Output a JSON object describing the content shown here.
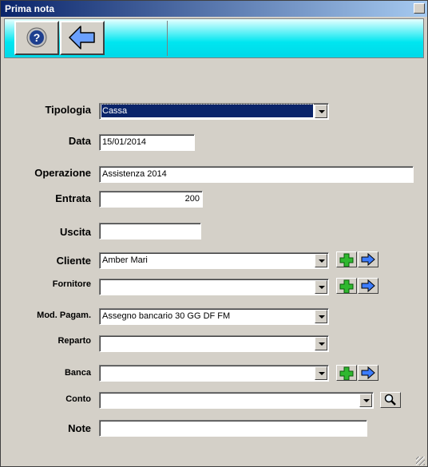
{
  "window": {
    "title": "Prima nota"
  },
  "toolbar": {
    "help_icon": "help-icon",
    "back_icon": "back-arrow-icon"
  },
  "colors": {
    "title_start": "#0a246a",
    "title_end": "#a6caf0",
    "toolbar": "#00e6f0",
    "face": "#d4d0c8"
  },
  "form": {
    "tipologia": {
      "label": "Tipologia",
      "value": "Cassa"
    },
    "data": {
      "label": "Data",
      "value": "15/01/2014"
    },
    "operazione": {
      "label": "Operazione",
      "value": "Assistenza 2014"
    },
    "entrata": {
      "label": "Entrata",
      "value": "200"
    },
    "uscita": {
      "label": "Uscita",
      "value": ""
    },
    "cliente": {
      "label": "Cliente",
      "value": "Amber Mari"
    },
    "fornitore": {
      "label": "Fornitore",
      "value": ""
    },
    "mod_pagam": {
      "label": "Mod. Pagam.",
      "value": "Assegno bancario 30 GG DF FM"
    },
    "reparto": {
      "label": "Reparto",
      "value": ""
    },
    "banca": {
      "label": "Banca",
      "value": ""
    },
    "conto": {
      "label": "Conto",
      "value": ""
    },
    "note": {
      "label": "Note",
      "value": ""
    }
  }
}
